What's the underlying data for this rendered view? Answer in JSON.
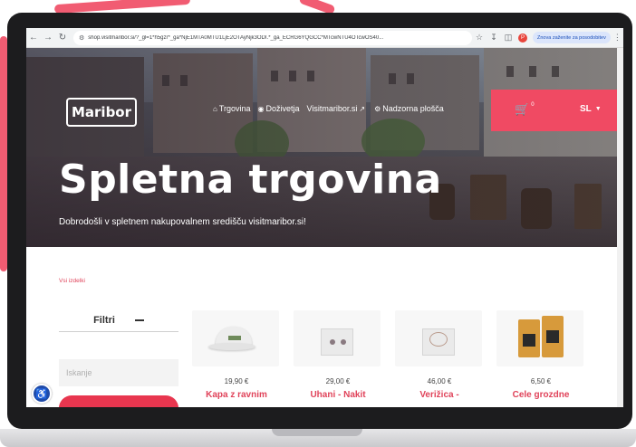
{
  "browser": {
    "url": "shop.visitmaribor.si/?_gl=1*h5gzr*_ga*NjE1MTA0MTU1LjE2OTAyNjk3ODI.*_ga_ECRG6YQGCC*MTcwNTU4OTcwOS40...",
    "extension_pill": "Znova zaženite za posodobitev"
  },
  "site": {
    "logo_text": "Maribor",
    "nav": [
      {
        "icon": "home-icon",
        "label": "Trgovina"
      },
      {
        "icon": "bicycle-icon",
        "label": "Doživetja"
      },
      {
        "icon": "external-link-icon",
        "label": "Visitmaribor.si"
      },
      {
        "icon": "gear-icon",
        "label": "Nadzorna plošča"
      }
    ],
    "cart_count": "0",
    "language": "SL"
  },
  "hero": {
    "title": "Spletna trgovina",
    "subtitle": "Dobrodošli v spletnem nakupovalnem središču visitmaribor.si!"
  },
  "breadcrumb": "Vsi izdelki",
  "filters": {
    "title": "Filtri",
    "search_placeholder": "Iskanje"
  },
  "products": [
    {
      "price": "19,90 €",
      "name": "Kapa z ravnim"
    },
    {
      "price": "29,00 €",
      "name": "Uhani - Nakit"
    },
    {
      "price": "46,00 €",
      "name": "Verižica -"
    },
    {
      "price": "6,50 €",
      "name": "Cele grozdne"
    }
  ],
  "colors": {
    "brand_red": "#f04a63",
    "accessibility_blue": "#1f4aa8"
  }
}
